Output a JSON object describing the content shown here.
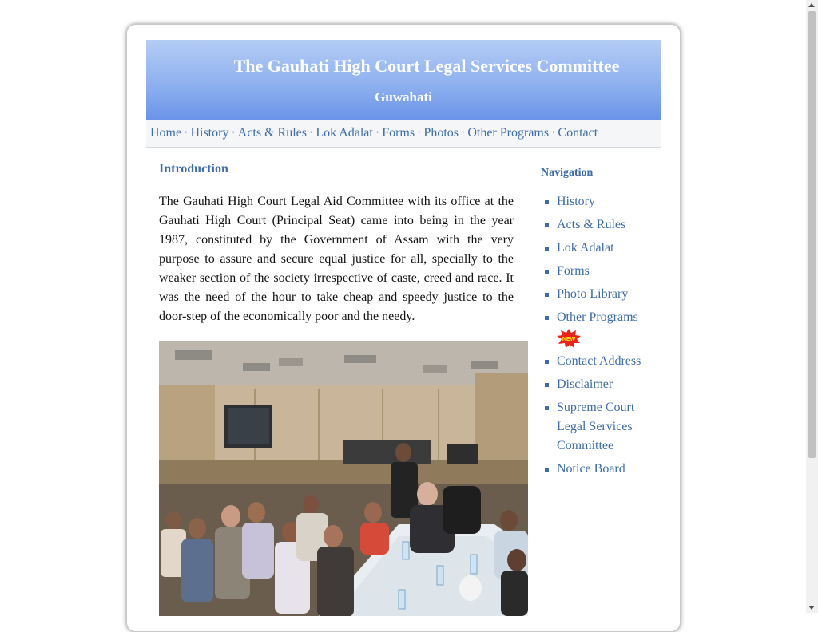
{
  "header": {
    "title": "The Gauhati High Court Legal Services Committee",
    "subtitle": "Guwahati"
  },
  "topnav": {
    "items": [
      "Home",
      "History",
      "Acts & Rules",
      "Lok Adalat",
      "Forms",
      "Photos",
      "Other Programs",
      "Contact"
    ],
    "separator": "·"
  },
  "intro": {
    "heading": "Introduction",
    "body": "The Gauhati High Court Legal Aid Committee with its office at the Gauhati High Court (Principal Seat) came into being in the year 1987, constituted by the Government of Assam with the very purpose to assure and secure equal justice for all, specially to the weaker section of the society irrespective of caste, creed and race. It was the need of the hour to take cheap and speedy justice to the door-step of the economically poor and the needy."
  },
  "sidebar": {
    "heading": "Navigation",
    "items": [
      "History",
      "Acts & Rules",
      "Lok Adalat",
      "Forms",
      "Photo Library",
      "Other Programs",
      "Contact Address",
      "Disclaimer",
      "Supreme Court Legal Services Committee",
      "Notice Board"
    ],
    "new_badge": "NEW"
  },
  "colors": {
    "link": "#3e6ca8",
    "header_gradient_top": "#b4cdf5",
    "header_gradient_bottom": "#6a94e8"
  }
}
